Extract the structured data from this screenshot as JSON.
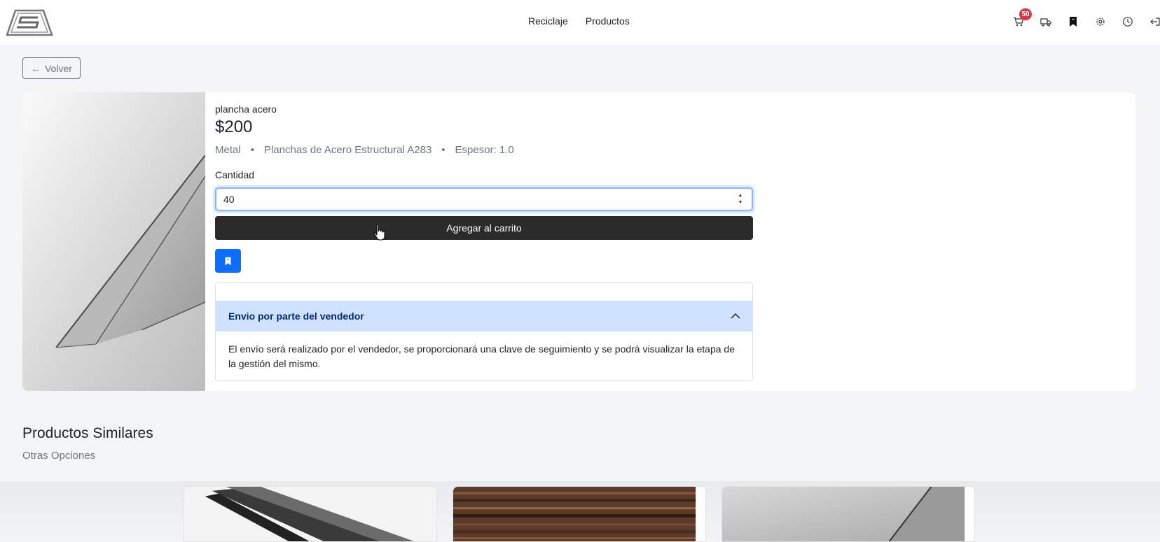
{
  "nav": {
    "links": [
      "Reciclaje",
      "Productos"
    ],
    "cart_count": "50",
    "icons": [
      "cart-icon",
      "truck-icon",
      "bookmark-icon",
      "gear-icon",
      "clock-icon",
      "logout-icon"
    ]
  },
  "back_button": {
    "arrow": "←",
    "label": "Volver"
  },
  "product": {
    "name": "plancha acero",
    "price": "$200",
    "material": "Metal",
    "category": "Planchas de Acero Estructural A283",
    "thickness": "Espesor: 1.0",
    "meta_separator": "•",
    "quantity_label": "Cantidad",
    "quantity_value": "40",
    "add_to_cart_label": "Agregar al carrito"
  },
  "shipping": {
    "title": "Envio por parte del vendedor",
    "body": "El envío será realizado por el vendedor, se proporcionará una clave de seguimiento y se podrá visualizar la etapa de la gestión del mismo."
  },
  "similar": {
    "title": "Productos Similares",
    "subtitle": "Otras Opciones",
    "items": [
      {
        "image": "dark-steel-sheets-photo"
      },
      {
        "image": "rusty-steel-plates-photo"
      },
      {
        "image": "galvanized-steel-sheet-photo"
      }
    ]
  },
  "colors": {
    "primary": "#0d6efd",
    "dark_button": "#2b2b2b",
    "accordion_header": "#cfe2ff",
    "badge": "#dc3545"
  }
}
